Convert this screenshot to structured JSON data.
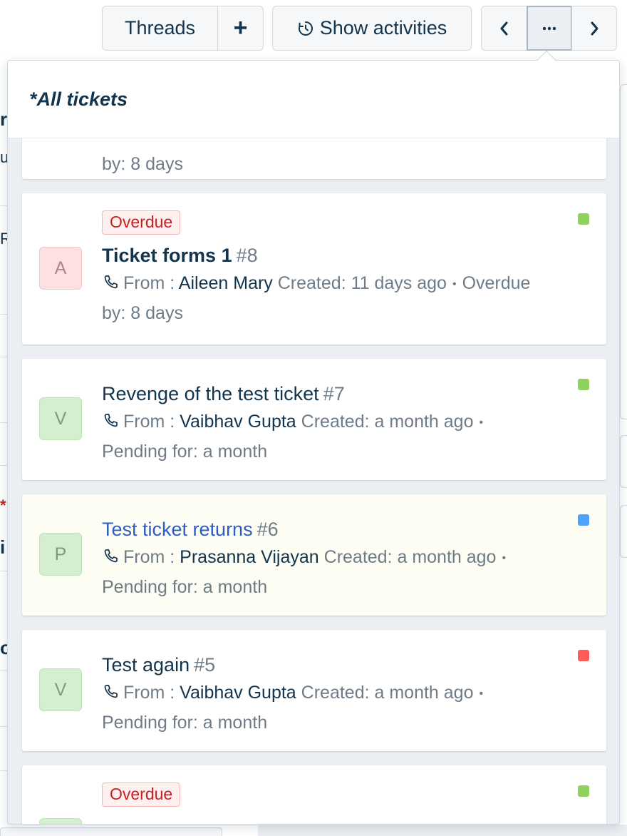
{
  "toolbar": {
    "threads_label": "Threads",
    "add_label": "+",
    "activities_label": "Show activities",
    "prev_label": "‹",
    "more_label": "···",
    "next_label": "›"
  },
  "dropdown": {
    "title": "*All tickets",
    "partial_top_text": "by: 8 days",
    "tickets": [
      {
        "badge": "Overdue",
        "avatar": "A",
        "subject": "Ticket forms 1",
        "number": "#8",
        "from_label": "From :",
        "from_name": "Aileen Mary",
        "created": "Created: 11 days ago",
        "status_line_1": "Overdue",
        "status_line_2": "by: 8 days",
        "status_color": "#8fd160"
      },
      {
        "avatar": "V",
        "subject": "Revenge of the test ticket",
        "number": "#7",
        "from_label": "From :",
        "from_name": "Vaibhav Gupta",
        "created": "Created: a month ago",
        "status_line_2": "Pending for: a month",
        "status_color": "#8fd160"
      },
      {
        "avatar": "P",
        "subject": "Test ticket returns",
        "number": "#6",
        "from_label": "From :",
        "from_name": "Prasanna Vijayan",
        "created": "Created: a month ago",
        "status_line_2": "Pending for: a month",
        "status_color": "#4da1ff"
      },
      {
        "avatar": "V",
        "subject": "Test again",
        "number": "#5",
        "from_label": "From :",
        "from_name": "Vaibhav Gupta",
        "created": "Created: a month ago",
        "status_line_2": "Pending for: a month",
        "status_color": "#ff5a5a"
      },
      {
        "badge": "Overdue",
        "status_color": "#8fd160"
      }
    ]
  },
  "background": {
    "letters": [
      "r",
      "u",
      "R",
      "*",
      "i",
      "o"
    ]
  }
}
